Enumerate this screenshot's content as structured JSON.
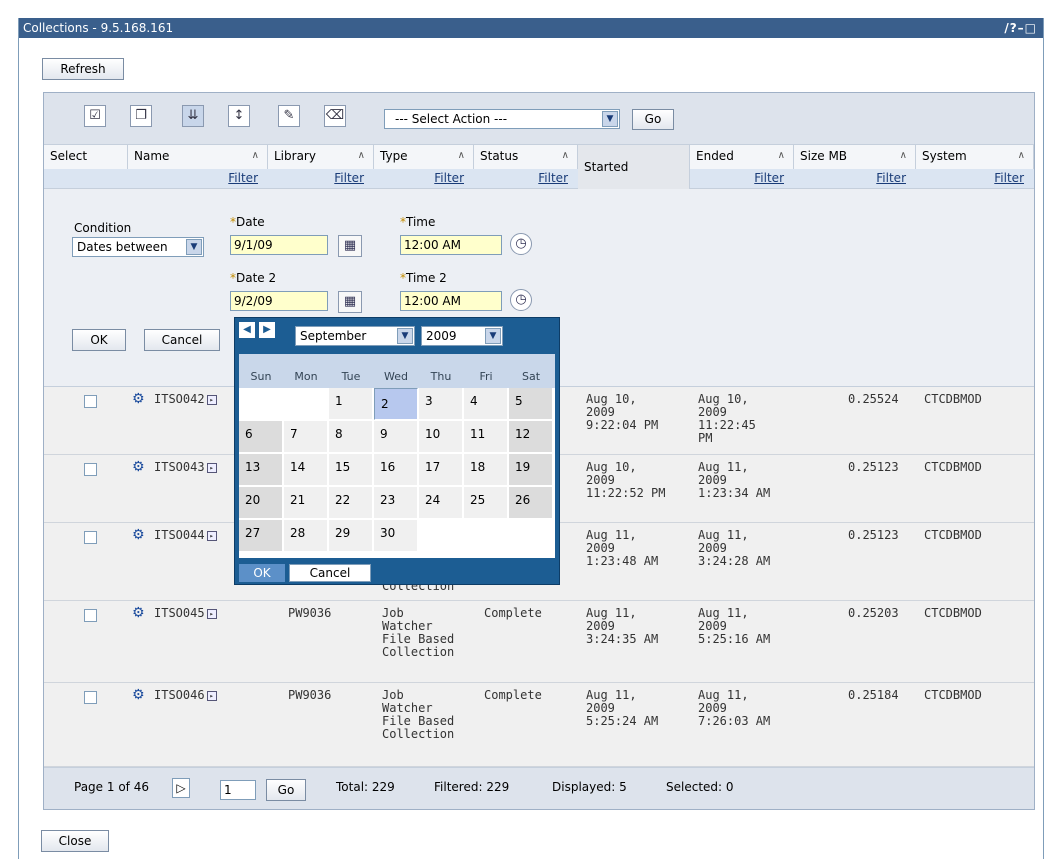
{
  "window": {
    "title": "Collections - 9.5.168.161",
    "controls": "/?–□"
  },
  "buttons": {
    "refresh": "Refresh",
    "close": "Close",
    "go": "Go",
    "ok": "OK",
    "cancel": "Cancel"
  },
  "toolbar": {
    "select_action": "--- Select Action ---"
  },
  "columns": {
    "select": "Select",
    "name": "Name",
    "library": "Library",
    "type": "Type",
    "status": "Status",
    "started": "Started",
    "ended": "Ended",
    "size": "Size MB",
    "system": "System",
    "filter": "Filter"
  },
  "filter": {
    "condition_label": "Condition",
    "condition_value": "Dates between",
    "date_label": "Date",
    "date_value": "9/1/09",
    "time_label": "Time",
    "time_value": "12:00 AM",
    "date2_label": "Date 2",
    "date2_value": "9/2/09",
    "time2_label": "Time 2",
    "time2_value": "12:00 AM"
  },
  "calendar": {
    "month": "September",
    "year": "2009",
    "weekdays": [
      "Sun",
      "Mon",
      "Tue",
      "Wed",
      "Thu",
      "Fri",
      "Sat"
    ],
    "selected_day": "2",
    "ok": "OK",
    "cancel": "Cancel"
  },
  "rows": [
    {
      "name": "ITSO042",
      "library": "",
      "type": "",
      "status": "",
      "started": "Aug 10,\n2009\n9:22:04 PM",
      "ended": "Aug 10,\n2009\n11:22:45\nPM",
      "size": "0.25524",
      "system": "CTCDBMOD"
    },
    {
      "name": "ITSO043",
      "library": "",
      "type": "",
      "status": "",
      "started": "Aug 10,\n2009\n11:22:52 PM",
      "ended": "Aug 11,\n2009\n1:23:34 AM",
      "size": "0.25123",
      "system": "CTCDBMOD"
    },
    {
      "name": "ITSO044",
      "library": "",
      "type": "File Based\nCollection",
      "status": "",
      "started": "Aug 11,\n2009\n1:23:48 AM",
      "ended": "Aug 11,\n2009\n3:24:28 AM",
      "size": "0.25123",
      "system": "CTCDBMOD"
    },
    {
      "name": "ITSO045",
      "library": "PW9036",
      "type": "Job\nWatcher\nFile Based\nCollection",
      "status": "Complete",
      "started": "Aug 11,\n2009\n3:24:35 AM",
      "ended": "Aug 11,\n2009\n5:25:16 AM",
      "size": "0.25203",
      "system": "CTCDBMOD"
    },
    {
      "name": "ITSO046",
      "library": "PW9036",
      "type": "Job\nWatcher\nFile Based\nCollection",
      "status": "Complete",
      "started": "Aug 11,\n2009\n5:25:24 AM",
      "ended": "Aug 11,\n2009\n7:26:03 AM",
      "size": "0.25184",
      "system": "CTCDBMOD"
    }
  ],
  "footer": {
    "page": "Page 1 of 46",
    "page_input": "1",
    "total": "Total: 229",
    "filtered": "Filtered: 229",
    "displayed": "Displayed: 5",
    "selected": "Selected: 0"
  }
}
